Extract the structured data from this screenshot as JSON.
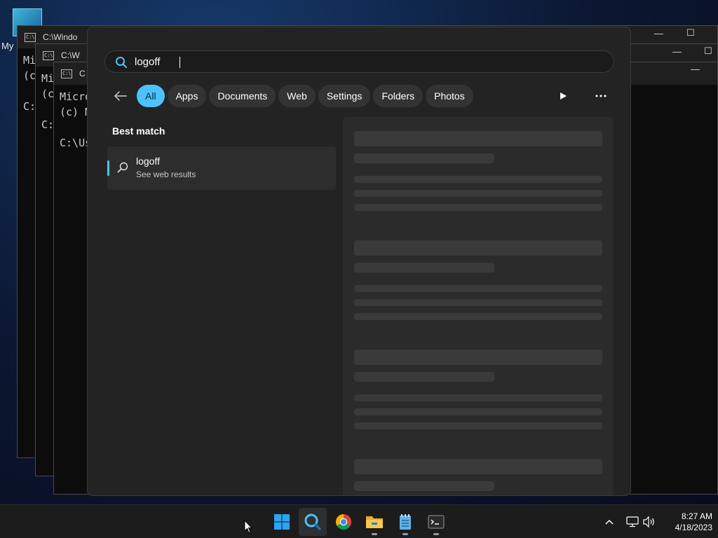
{
  "desktop": {
    "icon_label": "My"
  },
  "terminals": [
    {
      "title": "C:\\Windo",
      "lines": [
        "Mi",
        "(c",
        "",
        "C:"
      ]
    },
    {
      "title": "C:\\W",
      "lines": [
        "Mi",
        "(c",
        "",
        "C:"
      ]
    },
    {
      "title": "C",
      "lines": [
        "Micro",
        "(c) M",
        "",
        "C:\\Us"
      ]
    }
  ],
  "search": {
    "query": "logoff",
    "filters": [
      "All",
      "Apps",
      "Documents",
      "Web",
      "Settings",
      "Folders",
      "Photos"
    ],
    "active_filter": "All",
    "best_match_heading": "Best match",
    "best_match": {
      "title": "logoff",
      "subtitle": "See web results",
      "icon": "search-icon"
    }
  },
  "taskbar": {
    "apps": [
      "start-icon",
      "search-icon",
      "chrome-icon",
      "file-explorer-icon",
      "notepad-icon",
      "terminal-icon"
    ],
    "time": "8:27 AM",
    "date": "4/18/2023"
  },
  "colors": {
    "accent": "#4cc2ff",
    "panel": "#232323",
    "taskbar": "#1c1c1c"
  }
}
